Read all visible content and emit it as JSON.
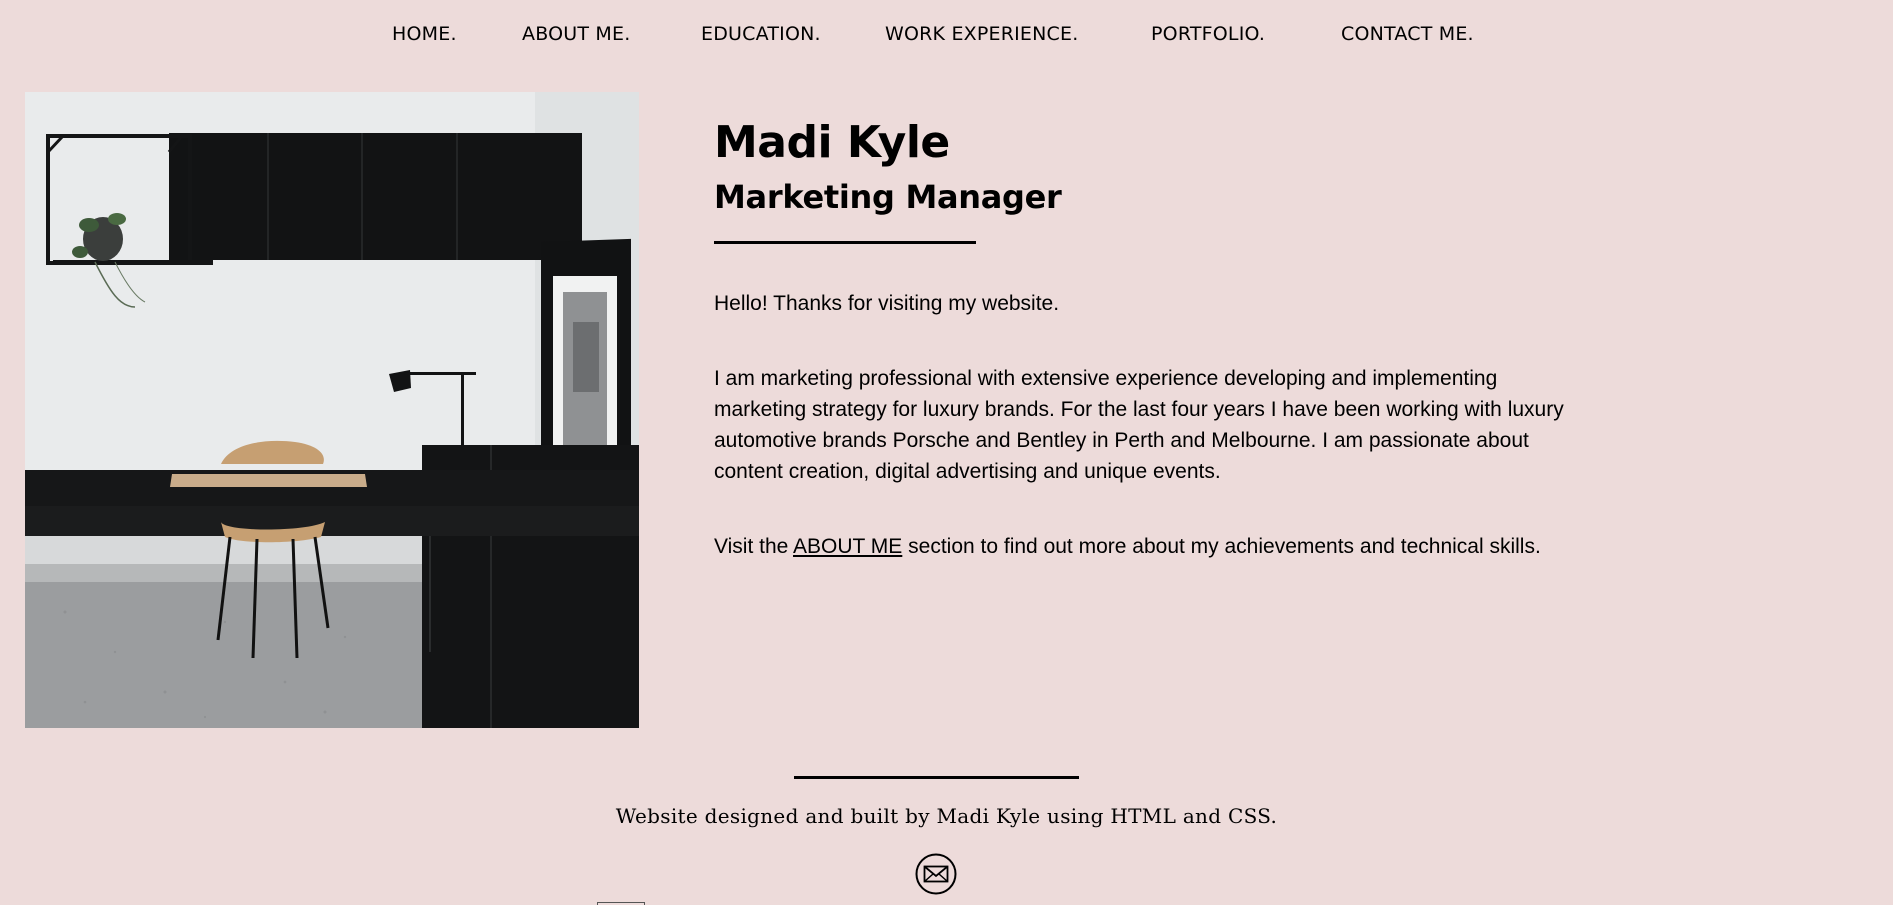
{
  "nav": {
    "items": [
      {
        "label": "HOME."
      },
      {
        "label": "ABOUT ME."
      },
      {
        "label": "EDUCATION."
      },
      {
        "label": "WORK EXPERIENCE."
      },
      {
        "label": "PORTFOLIO."
      },
      {
        "label": "CONTACT ME."
      }
    ]
  },
  "hero": {
    "name": "Madi Kyle",
    "role": "Marketing Manager"
  },
  "intro": {
    "greeting": "Hello! Thanks for visiting my website.",
    "bio": "I am marketing professional with extensive experience developing and implementing marketing strategy for luxury brands. For the last four years I have been working with luxury automotive brands Porsche and Bentley in Perth and Melbourne. I am passionate about content creation, digital advertising and unique events.",
    "visit_prefix": "Visit the",
    "visit_link": "ABOUT ME",
    "visit_suffix": "section to find out more about my achievements and technical skills."
  },
  "footer": {
    "credit": "Website designed and built by Madi Kyle using HTML and CSS.",
    "contact_icon": "mail-icon"
  },
  "colors": {
    "background": "#eddbda",
    "text": "#000000"
  }
}
